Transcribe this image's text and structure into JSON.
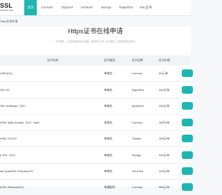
{
  "header": {
    "logo_text": "SSL",
    "logo_sub": "Internet.com",
    "nav": [
      {
        "label": "首页",
        "active": true
      },
      {
        "label": "Comodo",
        "active": false
      },
      {
        "label": "DigiCert",
        "active": false
      },
      {
        "label": "Geotrust",
        "active": false
      },
      {
        "label": "Sectigo",
        "active": false
      },
      {
        "label": "RapidSSL",
        "active": false
      },
      {
        "label": "SSL证书",
        "active": false
      }
    ]
  },
  "breadcrumb": "Https在线申请",
  "page": {
    "title": "Https证书在线申请",
    "subtitle": "证书服务，让您的网站安全可信赖，各种热门证书一站式购买，满足您的所有需求"
  },
  "table": {
    "columns": [
      "证书名称",
      "证书类型",
      "证书品牌",
      "证书价格"
    ],
    "rows": [
      {
        "name": "oSSL(DV)",
        "type": "单域名",
        "brand": "Comodo",
        "price": "90元/年"
      },
      {
        "name": "SSL DV",
        "type": "单域名",
        "brand": "RapidSSL",
        "price": "300元/年"
      },
      {
        "name": "SSL certificate（DV）",
        "type": "单域名",
        "brand": "AlphaSSL",
        "price": "250元/年"
      },
      {
        "name": "eSSL Multi-Domain（DV）2san",
        "type": "多域名",
        "brand": "Comodo",
        "price": "280元/年"
      },
      {
        "name": "eSSL 123 DV",
        "type": "单域名",
        "brand": "Thawte",
        "price": "280元/年"
      },
      {
        "name": "e SSL（DV）",
        "type": "单域名",
        "brand": "Sectigo",
        "price": "300元/年"
      },
      {
        "name": "ust QuickSSL Premium DV",
        "type": "单域名",
        "brand": "GeoTrust",
        "price": "400元/年"
      },
      {
        "name": "eSSL Wildcard(DV)",
        "type": "单通配符",
        "brand": "Comodo",
        "price": "980元/年"
      }
    ]
  }
}
